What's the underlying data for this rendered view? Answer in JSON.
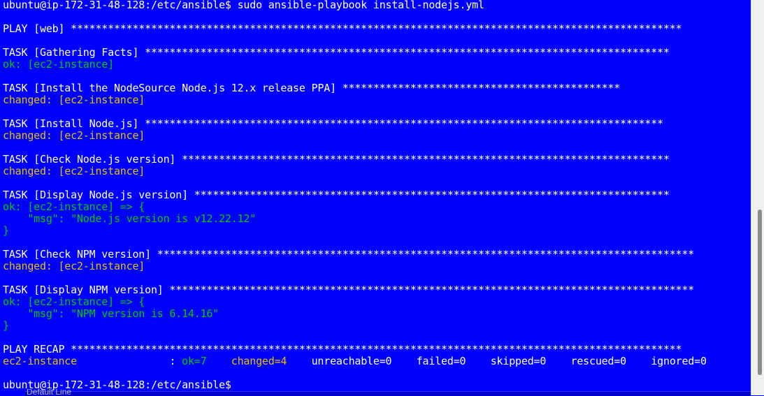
{
  "terminal": {
    "prompt_user_host": "ubuntu@ip-172-31-48-128:/etc/ansible$",
    "command": " sudo ansible-playbook install-nodejs.yml",
    "play_web": "PLAY [web] ***************************************************************************************************",
    "task_gathering": "TASK [Gathering Facts] *************************************************************************************",
    "ok_ec2": "ok: [ec2-instance]",
    "task_install_ppa": "TASK [Install the NodeSource Node.js 12.x release PPA] *********************************************",
    "changed_ec2": "changed: [ec2-instance]",
    "task_install_node": "TASK [Install Node.js] ************************************************************************************",
    "task_check_node": "TASK [Check Node.js version] *******************************************************************************",
    "task_display_node": "TASK [Display Node.js version] *****************************************************************************",
    "ok_ec2_arrow": "ok: [ec2-instance] => {",
    "msg_node": "    \"msg\": \"Node.js version is v12.22.12\"",
    "close_brace": "}",
    "task_check_npm": "TASK [Check NPM version] ***************************************************************************************",
    "task_display_npm": "TASK [Display NPM version] *************************************************************************************",
    "msg_npm": "    \"msg\": \"NPM version is 6.14.16\"",
    "play_recap": "PLAY RECAP ***************************************************************************************************",
    "recap": {
      "host": "ec2-instance",
      "sep": "               : ",
      "ok": "ok=7",
      "changed": "changed=4",
      "unreachable": "unreachable=0",
      "failed": "failed=0",
      "skipped": "skipped=0",
      "rescued": "rescued=0",
      "ignored": "ignored=0"
    },
    "final_prompt": "ubuntu@ip-172-31-48-128:/etc/ansible$"
  },
  "underlying_window_text": "Default  Line",
  "colors": {
    "background": "#0000ff",
    "text": "#ffffff",
    "ok": "#00cc00",
    "changed": "#e6c000"
  }
}
